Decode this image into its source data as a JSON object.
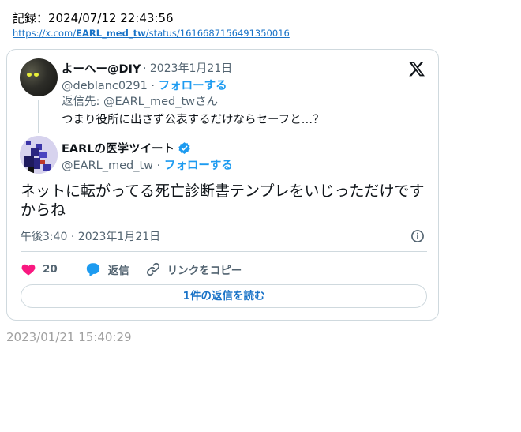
{
  "record": {
    "text": "記録：2024/07/12 22:43:56"
  },
  "source": {
    "prefix": "https://x.com/",
    "user": "EARL_med_tw",
    "suffix": "/status/1616687156491350016"
  },
  "quoted": {
    "name": "よーへー@DIY",
    "date": "· 2023年1月21日",
    "handle": "@deblanc0291 ·",
    "follow": "フォローする",
    "reply_to": "返信先: @EARL_med_twさん",
    "text": "つまり役所に出さず公表するだけならセーフと…？"
  },
  "author": {
    "name": "EARLの医学ツイート",
    "handle": "@EARL_med_tw ·",
    "follow": "フォローする"
  },
  "tweet": {
    "text": "ネットに転がってる死亡診断書テンプレをいじっただけですからね",
    "time": "午後3:40 · 2023年1月21日"
  },
  "actions": {
    "likes": "20",
    "reply": "返信",
    "copy": "リンクをコピー"
  },
  "read_replies": "1件の返信を読む",
  "timestamp": "2023/01/21 15:40:29",
  "colors": {
    "accent": "#1d9bf0",
    "like": "#f91880",
    "border": "#cfd9de"
  }
}
